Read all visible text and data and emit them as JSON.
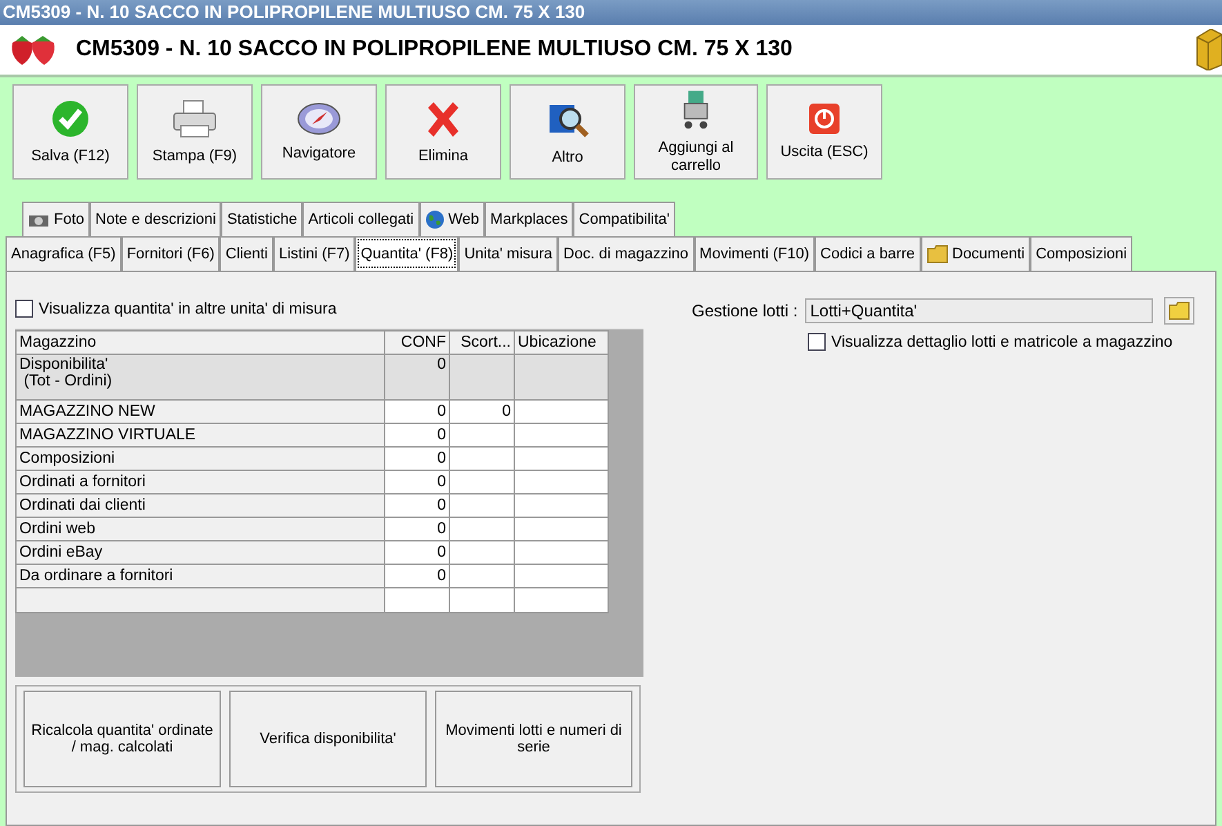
{
  "window": {
    "title": "CM5309 - N. 10 SACCO IN POLIPROPILENE MULTIUSO CM. 75 X 130"
  },
  "header": {
    "title": "CM5309 - N. 10 SACCO IN POLIPROPILENE MULTIUSO CM. 75 X 130"
  },
  "toolbar": [
    {
      "label": "Salva (F12)",
      "kind": "save"
    },
    {
      "label": "Stampa (F9)",
      "kind": "print"
    },
    {
      "label": "Navigatore",
      "kind": "compass"
    },
    {
      "label": "Elimina",
      "kind": "delete"
    },
    {
      "label": "Altro",
      "kind": "search"
    },
    {
      "label": "Aggiungi al carrello",
      "kind": "cart"
    },
    {
      "label": "Uscita (ESC)",
      "kind": "exit"
    }
  ],
  "tab_rows": [
    [
      {
        "label": "Foto",
        "kind": "camera",
        "selected": false
      },
      {
        "label": "Note e descrizioni",
        "kind": "plain",
        "selected": false
      },
      {
        "label": "Statistiche",
        "kind": "plain",
        "selected": false
      },
      {
        "label": "Articoli collegati",
        "kind": "plain",
        "selected": false
      },
      {
        "label": "Web",
        "kind": "globe",
        "selected": false
      },
      {
        "label": "Markplaces",
        "kind": "plain",
        "selected": false
      },
      {
        "label": "Compatibilita'",
        "kind": "plain",
        "selected": false
      }
    ],
    [
      {
        "label": "Anagrafica (F5)",
        "kind": "plain",
        "selected": false
      },
      {
        "label": "Fornitori (F6)",
        "kind": "plain",
        "selected": false
      },
      {
        "label": "Clienti",
        "kind": "plain",
        "selected": false
      },
      {
        "label": "Listini (F7)",
        "kind": "plain",
        "selected": false
      },
      {
        "label": "Quantita' (F8)",
        "kind": "plain",
        "selected": true
      },
      {
        "label": "Unita' misura",
        "kind": "plain",
        "selected": false
      },
      {
        "label": "Doc. di magazzino",
        "kind": "plain",
        "selected": false
      },
      {
        "label": "Movimenti (F10)",
        "kind": "plain",
        "selected": false
      },
      {
        "label": "Codici a barre",
        "kind": "plain",
        "selected": false
      },
      {
        "label": "Documenti",
        "kind": "folder",
        "selected": false
      },
      {
        "label": "Composizioni",
        "kind": "plain",
        "selected": false
      }
    ]
  ],
  "other_units_checkbox": {
    "label": "Visualizza quantita' in altre unita' di misura",
    "checked": false
  },
  "table": {
    "columns": [
      "Magazzino",
      "CONF",
      "Scort...",
      "Ubicazione"
    ],
    "rows": [
      {
        "kind": "total",
        "cells": [
          "Disponibilita'\n (Tot - Ordini)",
          "0",
          "",
          ""
        ]
      },
      {
        "kind": "store",
        "cells": [
          "MAGAZZINO NEW",
          "0",
          "0",
          ""
        ]
      },
      {
        "kind": "store",
        "cells": [
          "MAGAZZINO VIRTUALE",
          "0",
          "",
          ""
        ]
      },
      {
        "kind": "store",
        "cells": [
          "Composizioni",
          "0",
          "",
          ""
        ]
      },
      {
        "kind": "store",
        "cells": [
          "Ordinati a fornitori",
          "0",
          "",
          ""
        ]
      },
      {
        "kind": "store",
        "cells": [
          "Ordinati dai clienti",
          "0",
          "",
          ""
        ]
      },
      {
        "kind": "store",
        "cells": [
          "Ordini web",
          "0",
          "",
          ""
        ]
      },
      {
        "kind": "store",
        "cells": [
          "Ordini eBay",
          "0",
          "",
          ""
        ]
      },
      {
        "kind": "store",
        "cells": [
          "Da ordinare a fornitori",
          "0",
          "",
          ""
        ]
      }
    ]
  },
  "bottom_buttons": [
    "Ricalcola quantita' ordinate / mag. calcolati",
    "Verifica disponibilita'",
    "Movimenti lotti e numeri di serie"
  ],
  "lots": {
    "label": "Gestione lotti :",
    "value": "Lotti+Quantita'"
  },
  "lots_detail_checkbox": {
    "label": "Visualizza dettaglio lotti e matricole a magazzino",
    "checked": false
  }
}
